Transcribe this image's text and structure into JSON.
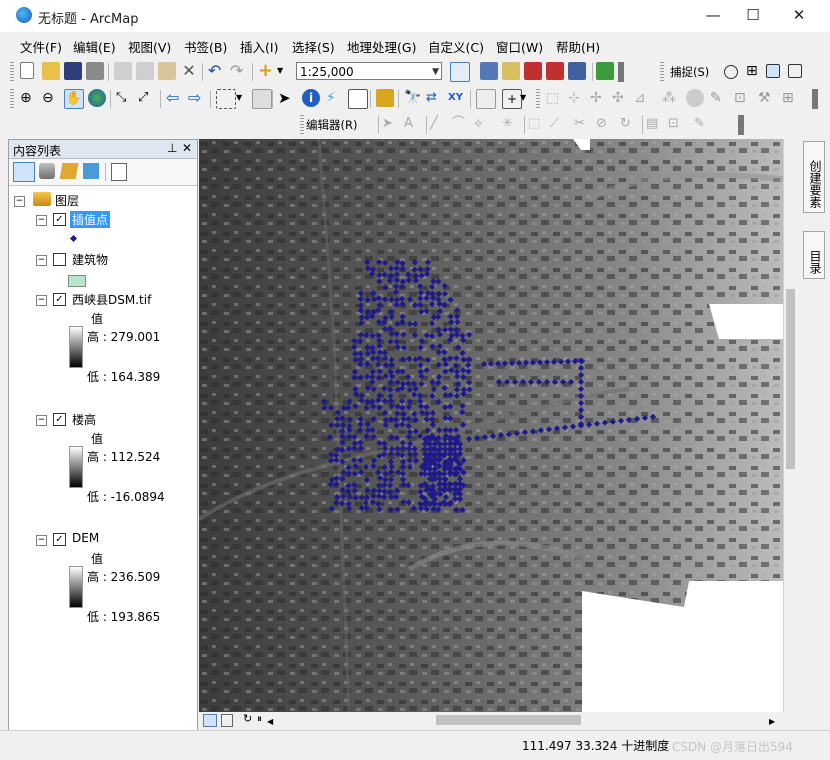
{
  "window": {
    "title": "无标题 - ArcMap",
    "controls": [
      "minimize",
      "maximize",
      "close"
    ]
  },
  "menu": [
    "文件(F)",
    "编辑(E)",
    "视图(V)",
    "书签(B)",
    "插入(I)",
    "选择(S)",
    "地理处理(G)",
    "自定义(C)",
    "窗口(W)",
    "帮助(H)"
  ],
  "toolbar": {
    "scale": "1:25,000",
    "snapping_label": "捕捉(S)",
    "editor_label": "编辑器(R)"
  },
  "toc": {
    "title": "内容列表",
    "root": "图层",
    "layers": [
      {
        "name": "插值点",
        "checked": true,
        "selected": true
      },
      {
        "name": "建筑物",
        "checked": false
      },
      {
        "name": "西峡县DSM.tif",
        "checked": true,
        "value_label": "值",
        "high": "高 : 279.001",
        "low": "低 : 164.389"
      },
      {
        "name": "楼高",
        "checked": true,
        "value_label": "值",
        "high": "高 : 112.524",
        "low": "低 : -16.0894"
      },
      {
        "name": "DEM",
        "checked": true,
        "value_label": "值",
        "high": "高 : 236.509",
        "low": "低 : 193.865"
      }
    ]
  },
  "side_tabs": [
    "创建要素",
    "目录"
  ],
  "status": {
    "coords": "111.497  33.324 十进制度",
    "watermark": "CSDN @月落日出594"
  },
  "colors": {
    "point_fill": "#1f1a8c",
    "selection": "#3399ff",
    "building_swatch": "#b8e6c8"
  },
  "icons": [
    "new-icon",
    "open-icon",
    "save-icon",
    "print-icon",
    "cut-icon",
    "copy-icon",
    "paste-icon",
    "delete-icon",
    "undo-icon",
    "redo-icon",
    "add-data-icon",
    "zoom-in-icon",
    "zoom-out-icon",
    "pan-icon",
    "globe-icon",
    "identify-icon",
    "measure-icon",
    "find-icon",
    "pin-icon",
    "close-icon"
  ]
}
